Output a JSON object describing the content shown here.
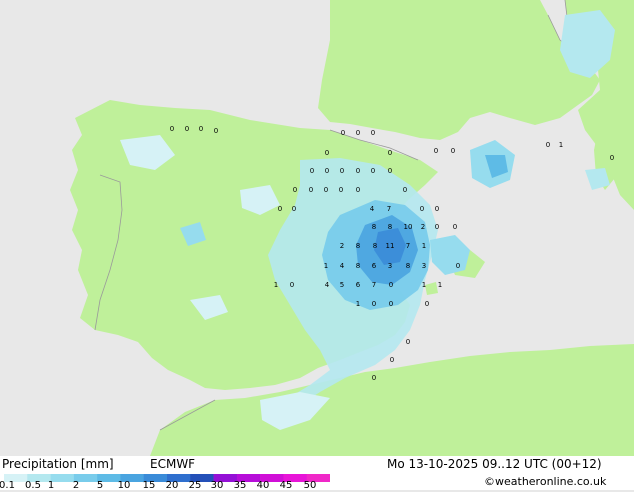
{
  "footer": {
    "title": "Precipitation [mm]",
    "model": "ECMWF",
    "valid_time": "Mo 13-10-2025 09..12 UTC (00+12)",
    "credit": "©weatheronline.co.uk"
  },
  "colorbar": {
    "ticks": [
      "0.1",
      "0.5",
      "1",
      "2",
      "5",
      "10",
      "15",
      "20",
      "25",
      "30",
      "35",
      "40",
      "45",
      "50"
    ],
    "colors": [
      "#d6f2f6",
      "#b4e8ef",
      "#96dcee",
      "#79cceb",
      "#5ebbe6",
      "#4aa4e0",
      "#3a8bd8",
      "#2f6fce",
      "#2450b8",
      "#9410d6",
      "#b60ed9",
      "#d00fd7",
      "#e815d8",
      "#f028c8"
    ]
  },
  "colors": {
    "sea": "#e8e8e8",
    "land": "#bff09a",
    "border": "#9a9a9a"
  },
  "map_values": [
    "0",
    "0",
    "0",
    "0",
    "0",
    "0",
    "0",
    "0",
    "0",
    "0",
    "0",
    "0",
    "1",
    "0",
    "0",
    "0",
    "0",
    "0",
    "0",
    "0",
    "0",
    "0",
    "0",
    "0",
    "0",
    "0",
    "0",
    "0",
    "4",
    "7",
    "0",
    "0",
    "8",
    "8",
    "10",
    "2",
    "0",
    "0",
    "2",
    "8",
    "8",
    "11",
    "7",
    "1",
    "1",
    "4",
    "8",
    "6",
    "3",
    "8",
    "3",
    "0",
    "1",
    "0",
    "4",
    "5",
    "6",
    "7",
    "0",
    "1",
    "1",
    "1",
    "0",
    "0",
    "0",
    "0",
    "0",
    "0"
  ]
}
